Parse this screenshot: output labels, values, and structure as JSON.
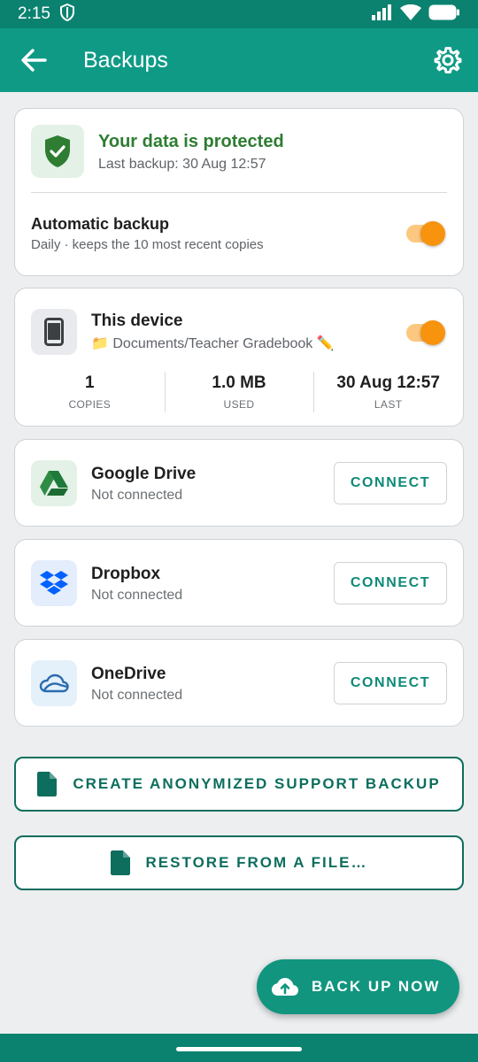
{
  "status_bar": {
    "time": "2:15"
  },
  "app_bar": {
    "title": "Backups"
  },
  "protection": {
    "title": "Your data is protected",
    "last_backup": "Last backup: 30 Aug 12:57",
    "auto_title": "Automatic backup",
    "auto_sub": "Daily · keeps the 10 most recent copies",
    "auto_enabled": true
  },
  "device": {
    "title": "This device",
    "path": "📁 Documents/Teacher Gradebook ✏️",
    "enabled": true,
    "stats": [
      {
        "value": "1",
        "label": "COPIES"
      },
      {
        "value": "1.0 MB",
        "label": "USED"
      },
      {
        "value": "30 Aug 12:57",
        "label": "LAST"
      }
    ]
  },
  "services": [
    {
      "name": "Google Drive",
      "status": "Not connected",
      "button": "CONNECT",
      "icon": "google-drive-icon"
    },
    {
      "name": "Dropbox",
      "status": "Not connected",
      "button": "CONNECT",
      "icon": "dropbox-icon"
    },
    {
      "name": "OneDrive",
      "status": "Not connected",
      "button": "CONNECT",
      "icon": "onedrive-icon"
    }
  ],
  "actions": {
    "support_backup": "CREATE ANONYMIZED SUPPORT BACKUP",
    "restore": "RESTORE FROM A FILE…",
    "backup_now": "BACK UP NOW"
  },
  "colors": {
    "primary": "#0f9a86",
    "status_bar": "#0b8270",
    "protected_green": "#2e7d32",
    "toggle_orange": "#f7930d",
    "dropbox_blue": "#0061fe"
  }
}
